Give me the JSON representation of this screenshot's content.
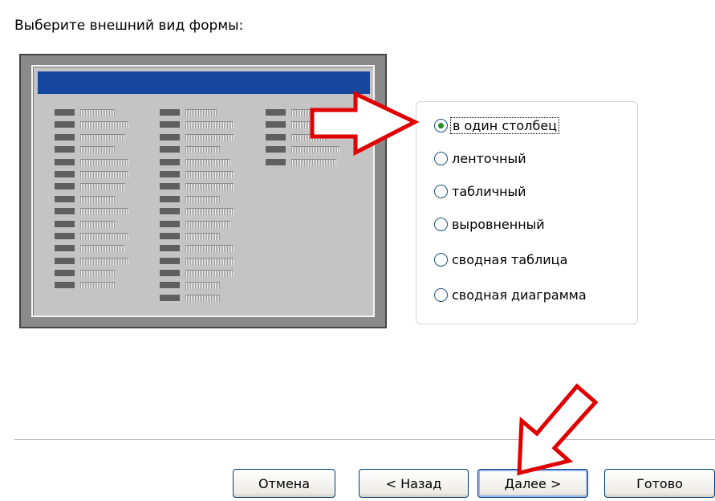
{
  "prompt": "Выберите внешний вид формы:",
  "options": [
    {
      "label": "в один столбец",
      "selected": true
    },
    {
      "label": "ленточный",
      "selected": false
    },
    {
      "label": "табличный",
      "selected": false
    },
    {
      "label": "выровненный",
      "selected": false
    },
    {
      "label": "сводная таблица",
      "selected": false
    },
    {
      "label": "сводная диаграмма",
      "selected": false
    }
  ],
  "buttons": {
    "cancel": "Отмена",
    "back": "< Назад",
    "next": "Далее >",
    "finish": "Готово"
  },
  "colors": {
    "preview_header": "#16479e",
    "arrow_fill": "#ffffff",
    "arrow_stroke": "#e00000",
    "radio_dot": "#2a8a2a",
    "button_border": "#003c74"
  }
}
